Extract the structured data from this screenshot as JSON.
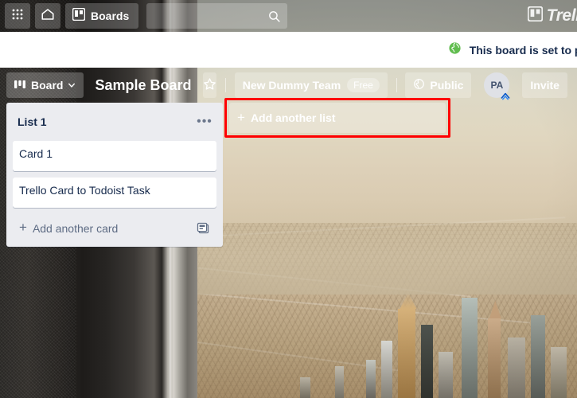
{
  "topbar": {
    "apps_icon": "grid-apps-icon",
    "home_icon": "home-icon",
    "boards_icon": "boards-icon",
    "boards_label": "Boards",
    "search_value": "",
    "search_placeholder": "",
    "search_icon": "search-icon",
    "logo_icon": "trello-logo-icon",
    "logo_text": "Trello"
  },
  "banner": {
    "icon": "globe-public-icon",
    "icon_color": "#61bd4f",
    "text": "This board is set to public. You can change",
    "background": "#ffffff",
    "text_color": "#172b4d"
  },
  "board_header": {
    "view_icon": "board-view-icon",
    "view_label": "Board",
    "view_chevron": "chevron-down-icon",
    "title": "Sample Board",
    "star_icon": "star-outline-icon",
    "team_name": "New Dummy Team",
    "team_plan_badge": "Free",
    "visibility_icon": "globe-public-icon",
    "visibility_label": "Public",
    "avatar_initials": "PA",
    "avatar_badge_icon": "atlassian-badge-icon",
    "invite_label": "Invite"
  },
  "lists": [
    {
      "title": "List 1",
      "menu_icon": "list-menu-ellipsis-icon",
      "cards": [
        {
          "title": "Card 1"
        },
        {
          "title": "Trello Card to Todoist Task"
        }
      ],
      "add_card_icon": "plus-icon",
      "add_card_label": "Add another card",
      "template_icon": "card-template-icon"
    }
  ],
  "add_list": {
    "icon": "plus-icon",
    "label": "Add another list",
    "highlighted": true,
    "highlight_color": "#ff0000"
  }
}
